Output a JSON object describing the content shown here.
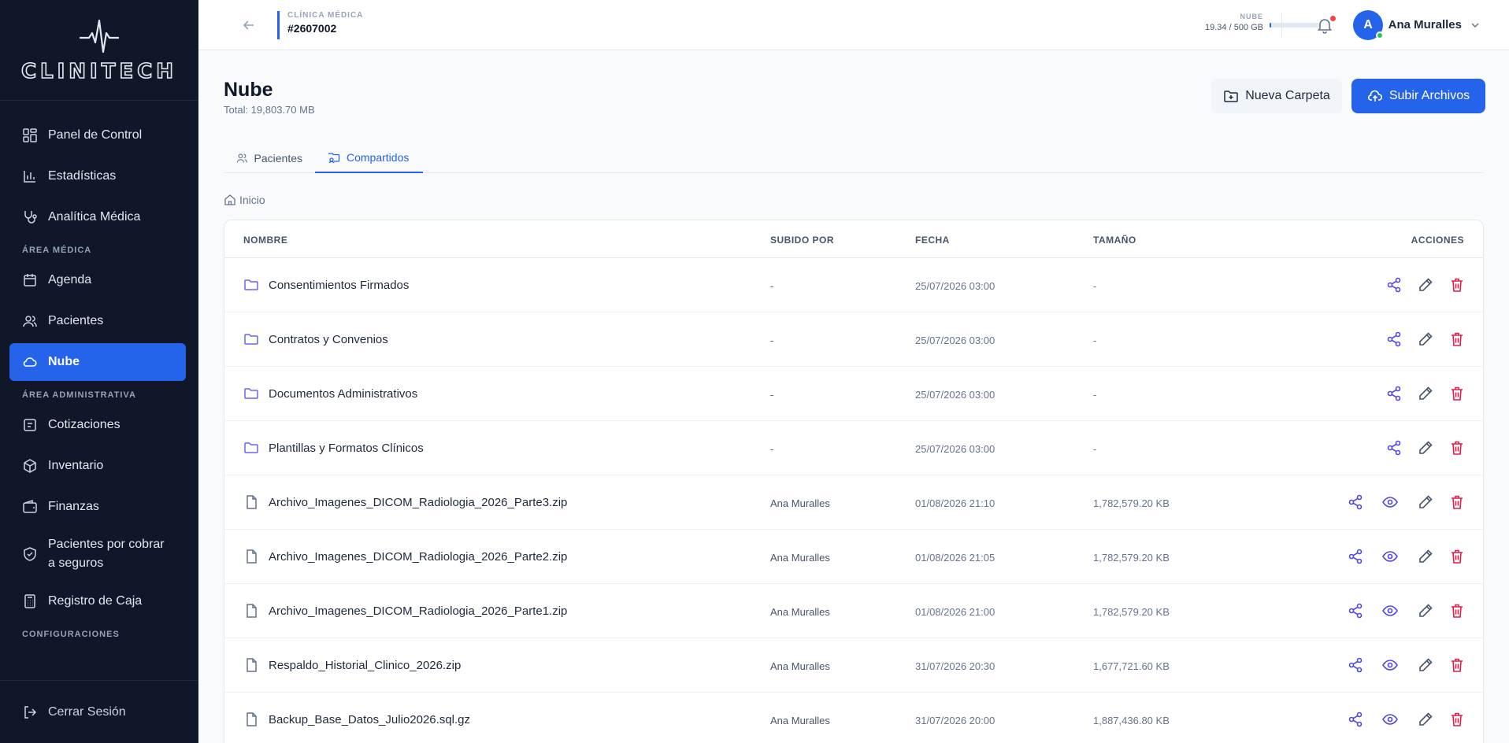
{
  "brand": {
    "name": "CLINITECH"
  },
  "sidebar": {
    "items_main": [
      {
        "label": "Panel de Control",
        "icon": "dashboard-icon"
      },
      {
        "label": "Estadísticas",
        "icon": "bar-chart-icon"
      },
      {
        "label": "Analítica Médica",
        "icon": "stethoscope-icon"
      }
    ],
    "section_medical": "ÁREA MÉDICA",
    "items_medical": [
      {
        "label": "Agenda",
        "icon": "calendar-icon"
      },
      {
        "label": "Pacientes",
        "icon": "users-icon"
      },
      {
        "label": "Nube",
        "icon": "cloud-icon",
        "active": true
      }
    ],
    "section_admin": "ÁREA ADMINISTRATIVA",
    "items_admin": [
      {
        "label": "Cotizaciones",
        "icon": "quote-icon"
      },
      {
        "label": "Inventario",
        "icon": "box-icon"
      },
      {
        "label": "Finanzas",
        "icon": "wallet-icon"
      },
      {
        "label": "Pacientes por cobrar a seguros",
        "icon": "shield-icon"
      },
      {
        "label": "Registro de Caja",
        "icon": "calculator-icon"
      }
    ],
    "section_config": "CONFIGURACIONES",
    "logout": "Cerrar Sesión"
  },
  "header": {
    "clinic_label": "CLÍNICA MÉDICA",
    "clinic_id": "#2607002",
    "storage_label": "NUBE",
    "storage_value": "19.34 / 500 GB",
    "storage_fraction": 0.0387,
    "user_initial": "A",
    "user_name": "Ana Muralles"
  },
  "page": {
    "title": "Nube",
    "subtitle": "Total: 19,803.70 MB",
    "new_folder": "Nueva Carpeta",
    "upload": "Subir Archivos",
    "tabs": [
      {
        "label": "Pacientes",
        "active": false
      },
      {
        "label": "Compartidos",
        "active": true
      }
    ],
    "breadcrumb": "Inicio"
  },
  "table": {
    "headers": {
      "name": "NOMBRE",
      "uploaded_by": "SUBIDO POR",
      "date": "FECHA",
      "size": "TAMAÑO",
      "actions": "ACCIONES"
    },
    "rows": [
      {
        "type": "folder",
        "name": "Consentimientos Firmados",
        "uploaded_by": "-",
        "date": "25/07/2026 03:00",
        "size": "-"
      },
      {
        "type": "folder",
        "name": "Contratos y Convenios",
        "uploaded_by": "-",
        "date": "25/07/2026 03:00",
        "size": "-"
      },
      {
        "type": "folder",
        "name": "Documentos Administrativos",
        "uploaded_by": "-",
        "date": "25/07/2026 03:00",
        "size": "-"
      },
      {
        "type": "folder",
        "name": "Plantillas y Formatos Clínicos",
        "uploaded_by": "-",
        "date": "25/07/2026 03:00",
        "size": "-"
      },
      {
        "type": "file",
        "name": "Archivo_Imagenes_DICOM_Radiologia_2026_Parte3.zip",
        "uploaded_by": "Ana Muralles",
        "date": "01/08/2026 21:10",
        "size": "1,782,579.20 KB"
      },
      {
        "type": "file",
        "name": "Archivo_Imagenes_DICOM_Radiologia_2026_Parte2.zip",
        "uploaded_by": "Ana Muralles",
        "date": "01/08/2026 21:05",
        "size": "1,782,579.20 KB"
      },
      {
        "type": "file",
        "name": "Archivo_Imagenes_DICOM_Radiologia_2026_Parte1.zip",
        "uploaded_by": "Ana Muralles",
        "date": "01/08/2026 21:00",
        "size": "1,782,579.20 KB"
      },
      {
        "type": "file",
        "name": "Respaldo_Historial_Clinico_2026.zip",
        "uploaded_by": "Ana Muralles",
        "date": "31/07/2026 20:30",
        "size": "1,677,721.60 KB"
      },
      {
        "type": "file",
        "name": "Backup_Base_Datos_Julio2026.sql.gz",
        "uploaded_by": "Ana Muralles",
        "date": "31/07/2026 20:00",
        "size": "1,887,436.80 KB"
      }
    ]
  },
  "colors": {
    "sidebar_bg": "#0f1729",
    "accent": "#2563eb",
    "danger": "#e11d48",
    "action_icon": "#4f46e5"
  }
}
